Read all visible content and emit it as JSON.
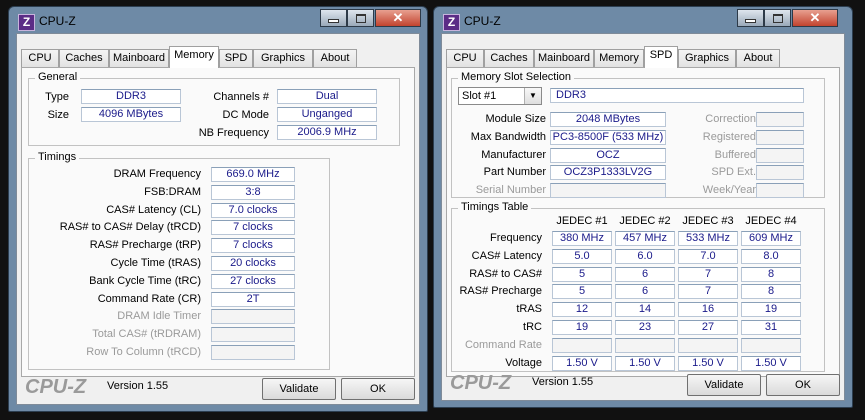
{
  "app": {
    "title": "CPU-Z",
    "icon_letter": "Z",
    "logo": "CPU-Z",
    "version": "Version 1.55"
  },
  "window_buttons": {
    "close_glyph": "✕"
  },
  "tabs": [
    "CPU",
    "Caches",
    "Mainboard",
    "Memory",
    "SPD",
    "Graphics",
    "About"
  ],
  "buttons": {
    "validate": "Validate",
    "ok": "OK"
  },
  "memory": {
    "general_title": "General",
    "type_label": "Type",
    "type": "DDR3",
    "size_label": "Size",
    "size": "4096 MBytes",
    "channels_label": "Channels #",
    "channels": "Dual",
    "dcmode_label": "DC Mode",
    "dcmode": "Unganged",
    "nbfreq_label": "NB Frequency",
    "nbfreq": "2006.9 MHz",
    "timings_title": "Timings",
    "timings": [
      {
        "label": "DRAM Frequency",
        "value": "669.0 MHz",
        "dim": false
      },
      {
        "label": "FSB:DRAM",
        "value": "3:8",
        "dim": false
      },
      {
        "label": "CAS# Latency (CL)",
        "value": "7.0 clocks",
        "dim": false
      },
      {
        "label": "RAS# to CAS# Delay (tRCD)",
        "value": "7 clocks",
        "dim": false
      },
      {
        "label": "RAS# Precharge (tRP)",
        "value": "7 clocks",
        "dim": false
      },
      {
        "label": "Cycle Time (tRAS)",
        "value": "20 clocks",
        "dim": false
      },
      {
        "label": "Bank Cycle Time (tRC)",
        "value": "27 clocks",
        "dim": false
      },
      {
        "label": "Command Rate (CR)",
        "value": "2T",
        "dim": false
      },
      {
        "label": "DRAM Idle Timer",
        "value": "",
        "dim": true
      },
      {
        "label": "Total CAS# (tRDRAM)",
        "value": "",
        "dim": true
      },
      {
        "label": "Row To Column (tRCD)",
        "value": "",
        "dim": true
      }
    ]
  },
  "spd": {
    "slot_title": "Memory Slot Selection",
    "slot_selected": "Slot #1",
    "slot_type": "DDR3",
    "left_fields": [
      {
        "label": "Module Size",
        "value": "2048 MBytes",
        "dim": false
      },
      {
        "label": "Max Bandwidth",
        "value": "PC3-8500F (533 MHz)",
        "dim": false
      },
      {
        "label": "Manufacturer",
        "value": "OCZ",
        "dim": false
      },
      {
        "label": "Part Number",
        "value": "OCZ3P1333LV2G",
        "dim": false
      },
      {
        "label": "Serial Number",
        "value": "",
        "dim": true
      }
    ],
    "right_fields": [
      {
        "label": "Correction",
        "value": ""
      },
      {
        "label": "Registered",
        "value": ""
      },
      {
        "label": "Buffered",
        "value": ""
      },
      {
        "label": "SPD Ext.",
        "value": ""
      },
      {
        "label": "Week/Year",
        "value": ""
      }
    ],
    "timings_title": "Timings Table",
    "headers": [
      "JEDEC #1",
      "JEDEC #2",
      "JEDEC #3",
      "JEDEC #4"
    ],
    "rows": [
      {
        "label": "Frequency",
        "values": [
          "380 MHz",
          "457 MHz",
          "533 MHz",
          "609 MHz"
        ],
        "dim": false
      },
      {
        "label": "CAS# Latency",
        "values": [
          "5.0",
          "6.0",
          "7.0",
          "8.0"
        ],
        "dim": false
      },
      {
        "label": "RAS# to CAS#",
        "values": [
          "5",
          "6",
          "7",
          "8"
        ],
        "dim": false
      },
      {
        "label": "RAS# Precharge",
        "values": [
          "5",
          "6",
          "7",
          "8"
        ],
        "dim": false
      },
      {
        "label": "tRAS",
        "values": [
          "12",
          "14",
          "16",
          "19"
        ],
        "dim": false
      },
      {
        "label": "tRC",
        "values": [
          "19",
          "23",
          "27",
          "31"
        ],
        "dim": false
      },
      {
        "label": "Command Rate",
        "values": [
          "",
          "",
          "",
          ""
        ],
        "dim": true
      },
      {
        "label": "Voltage",
        "values": [
          "1.50 V",
          "1.50 V",
          "1.50 V",
          "1.50 V"
        ],
        "dim": false
      }
    ]
  }
}
